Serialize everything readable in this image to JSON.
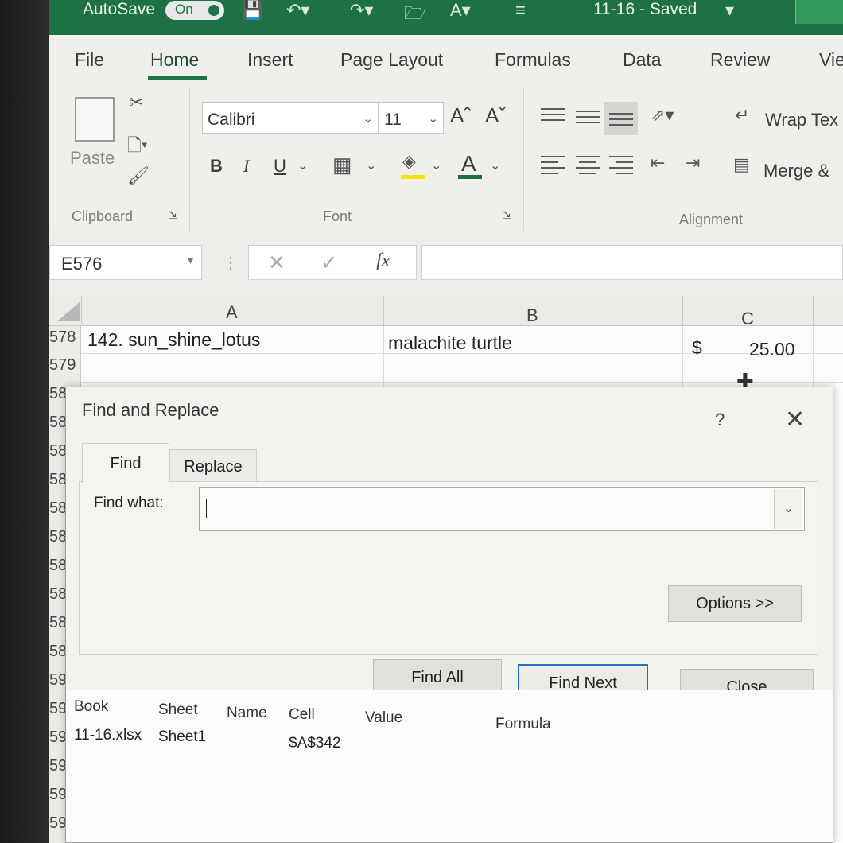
{
  "titlebar": {
    "autosave_label": "AutoSave",
    "toggle_state": "On",
    "doc_title": "11-16 - Saved",
    "colors": {
      "bar": "#1e7145"
    }
  },
  "ribbon": {
    "tabs": [
      "File",
      "Home",
      "Insert",
      "Page Layout",
      "Formulas",
      "Data",
      "Review",
      "Vie"
    ],
    "active_tab": "Home",
    "clipboard": {
      "paste_label": "Paste",
      "group_label": "Clipboard"
    },
    "font": {
      "name": "Calibri",
      "size": "11",
      "bold": "B",
      "italic": "I",
      "underline": "U",
      "group_label": "Font"
    },
    "alignment": {
      "wrap_label": "Wrap Tex",
      "merge_label": "Merge &",
      "group_label": "Alignment"
    }
  },
  "formula_bar": {
    "name_box": "E576",
    "cancel_icon": "cancel-icon",
    "enter_icon": "check-icon",
    "fx_label": "fx",
    "formula": ""
  },
  "sheet": {
    "columns": [
      "A",
      "B",
      "C"
    ],
    "rows": [
      {
        "num": "578",
        "a": "142. sun_shine_lotus",
        "b": "malachite turtle",
        "c_currency": "$",
        "c_value": "25.00"
      },
      {
        "num": "579",
        "a": "",
        "b": "",
        "c_currency": "",
        "c_value": ""
      }
    ],
    "row_stubs": [
      "58",
      "58",
      "58",
      "58",
      "58",
      "58",
      "58",
      "58",
      "58",
      "58",
      "59",
      "59",
      "59",
      "59",
      "59",
      "59",
      "59"
    ]
  },
  "dialog": {
    "title": "Find and Replace",
    "help": "?",
    "tabs": {
      "find": "Find",
      "replace": "Replace"
    },
    "find_what_label": "Find what:",
    "find_what_value": "",
    "buttons": {
      "options": "Options >>",
      "find_all": "Find All",
      "find_next": "Find Next",
      "close": "Close"
    },
    "results": {
      "headers": {
        "book": "Book",
        "sheet": "Sheet",
        "name": "Name",
        "cell": "Cell",
        "value": "Value",
        "formula": "Formula"
      },
      "rows": [
        {
          "book": "11-16.xlsx",
          "sheet": "Sheet1",
          "name": "",
          "cell": "$A$342",
          "value": "",
          "formula": ""
        }
      ]
    }
  }
}
